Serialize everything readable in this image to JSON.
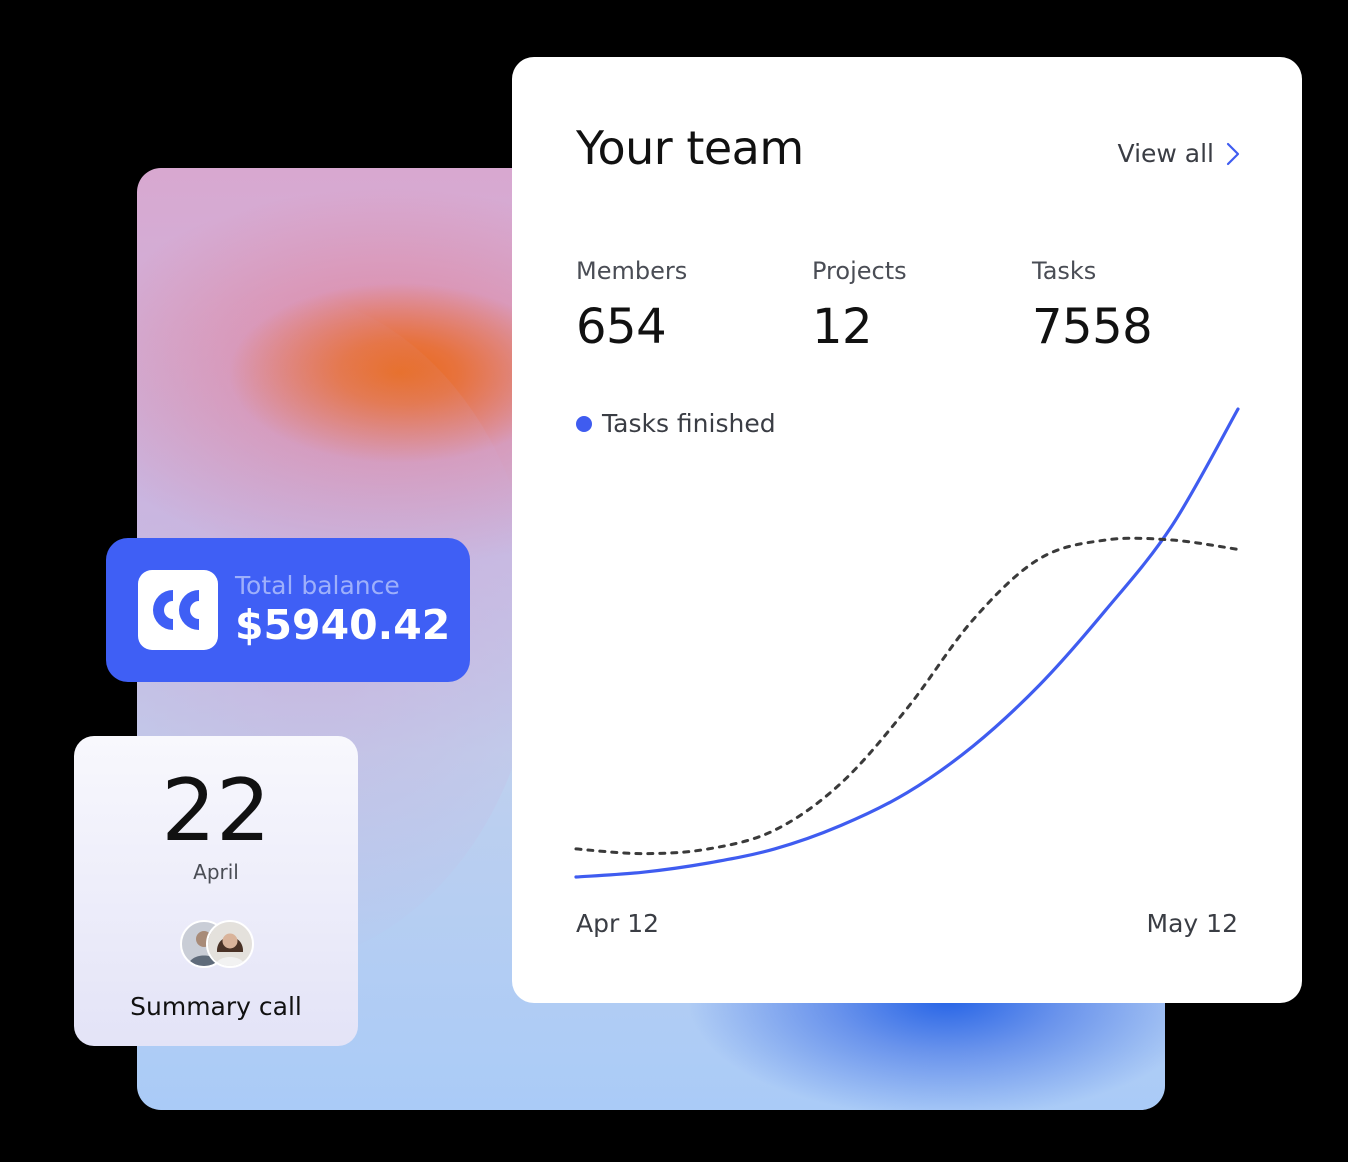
{
  "team": {
    "title": "Your team",
    "view_all_label": "View all",
    "stats": [
      {
        "label": "Members",
        "value": "654"
      },
      {
        "label": "Projects",
        "value": "12"
      },
      {
        "label": "Tasks",
        "value": "7558"
      }
    ],
    "legend_label": "Tasks finished",
    "accent_color": "#3f5cf0"
  },
  "chart_data": {
    "type": "line",
    "x_start_label": "Apr 12",
    "x_end_label": "May 12",
    "series": [
      {
        "name": "Tasks finished",
        "style": "solid",
        "color": "#3f5cf0",
        "values": [
          0.0,
          0.01,
          0.03,
          0.06,
          0.11,
          0.18,
          0.28,
          0.41,
          0.57,
          0.75,
          1.0
        ]
      },
      {
        "style": "dotted",
        "color": "#3a3a3a",
        "values": [
          0.06,
          0.05,
          0.06,
          0.1,
          0.2,
          0.36,
          0.55,
          0.68,
          0.72,
          0.72,
          0.7
        ]
      }
    ],
    "grid": false,
    "legend": "top-left"
  },
  "balance": {
    "label": "Total balance",
    "value": "$5940.42",
    "color": "#3f5ff5"
  },
  "call": {
    "day": "22",
    "month": "April",
    "title": "Summary call"
  },
  "icons": [
    "chevron-right-icon",
    "cc-logo-icon",
    "avatar-man",
    "avatar-woman"
  ]
}
